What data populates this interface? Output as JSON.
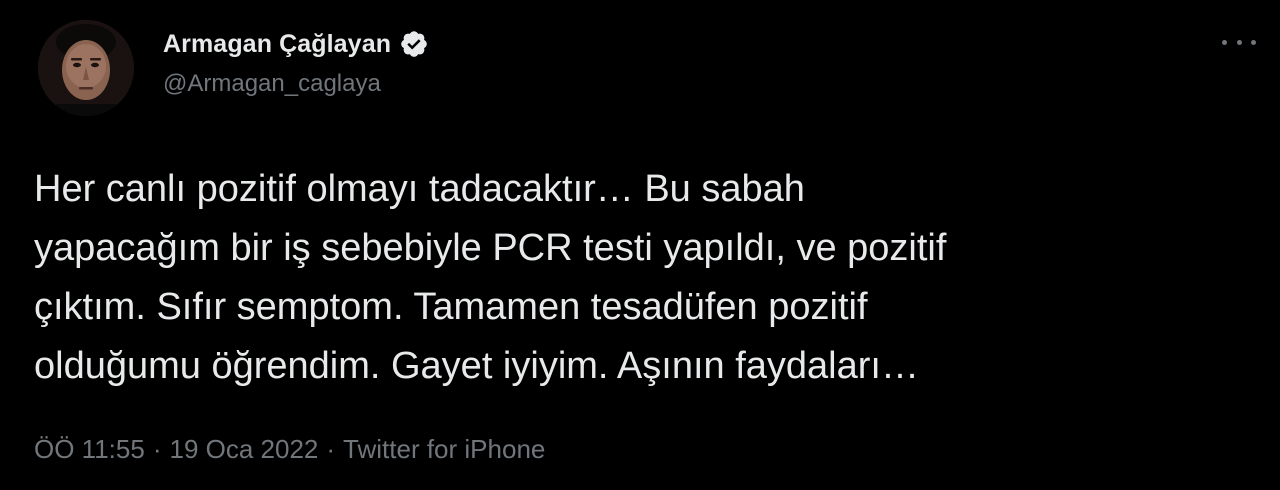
{
  "author": {
    "display_name": "Armagan Çağlayan",
    "handle": "@Armagan_caglaya",
    "verified_icon": "verified-badge-icon",
    "avatar_icon": "profile-photo"
  },
  "menu": {
    "icon": "more-options-icon"
  },
  "tweet": {
    "text": "Her canlı pozitif olmayı tadacaktır… Bu sabah\nyapacağım bir iş sebebiyle PCR testi yapıldı, ve pozitif\nçıktım. Sıfır semptom. Tamamen tesadüfen pozitif\nolduğumu öğrendim. Gayet iyiyim. Aşının faydaları…"
  },
  "meta": {
    "time": "ÖÖ 11:55",
    "separator": "·",
    "date": "19 Oca 2022",
    "source": "Twitter for iPhone"
  },
  "colors": {
    "background": "#000000",
    "text_primary": "#e7e9ea",
    "text_secondary": "#71767b",
    "verified_badge": "#e7e9ea"
  }
}
